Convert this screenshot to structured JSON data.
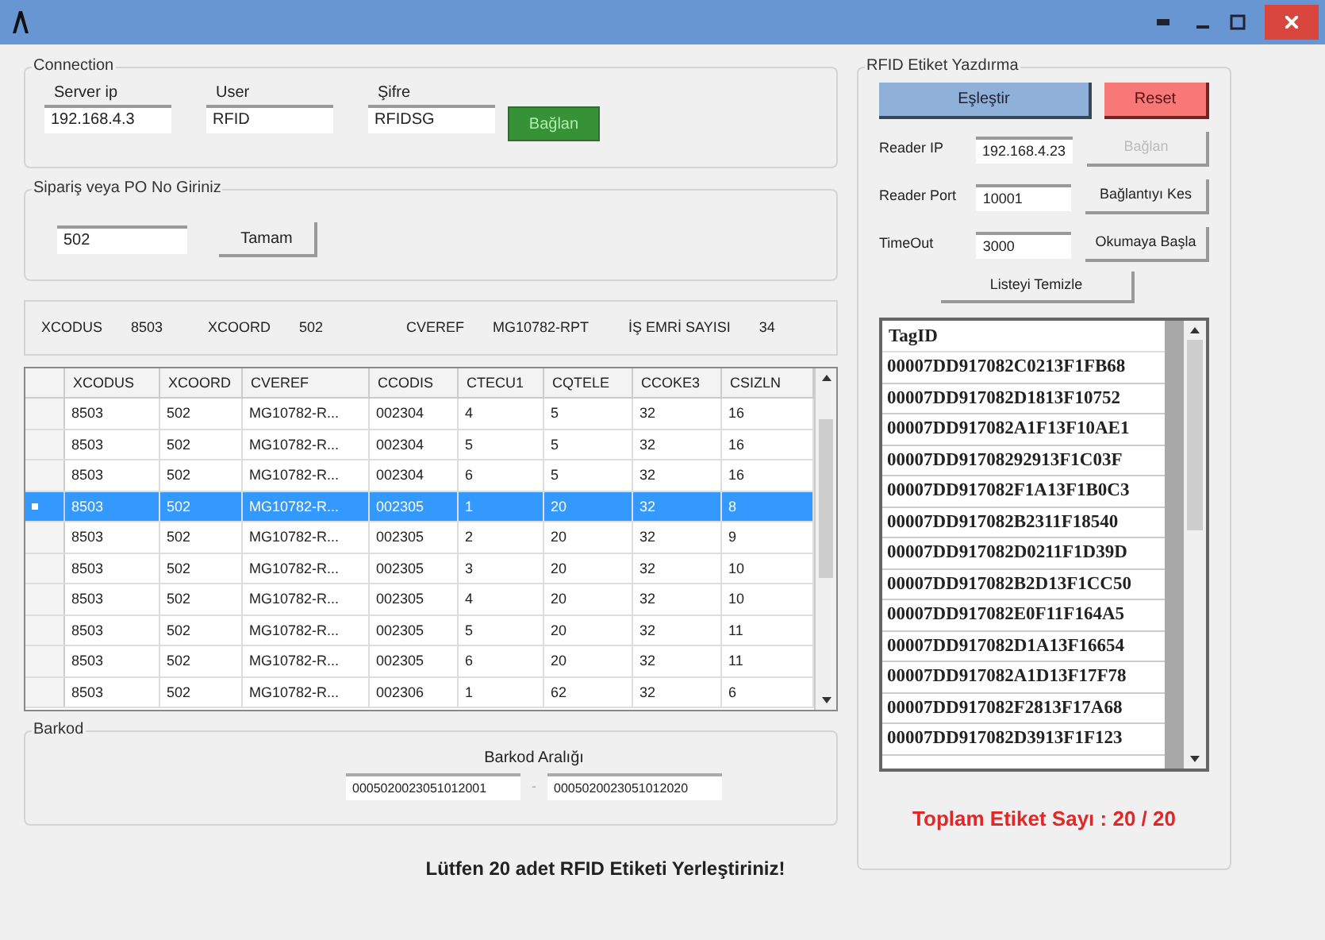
{
  "connection": {
    "title": "Connection",
    "fields": [
      {
        "label": "Server ip",
        "value": "192.168.4.3"
      },
      {
        "label": "User",
        "value": "RFID"
      },
      {
        "label": "Şifre",
        "value": "RFIDSG"
      }
    ],
    "button": {
      "label": "Bağlan",
      "kind": "success",
      "disabled": true
    }
  },
  "order": {
    "title": "Sipariş veya PO No Giriniz",
    "value": "502",
    "button": "Tamam"
  },
  "info": [
    {
      "label": "XCODUS",
      "value": "8503"
    },
    {
      "label": "XCOORD",
      "value": "502"
    },
    {
      "label": "CVEREF",
      "value": "MG10782-RPT"
    },
    {
      "label": "İŞ EMRİ SAYISI",
      "value": "34"
    }
  ],
  "table": {
    "columns": [
      "XCODUS",
      "XCOORD",
      "CVEREF",
      "CCODIS",
      "CTECU1",
      "CQTELE",
      "CCOKE3",
      "CSIZLN"
    ],
    "rows": [
      {
        "selected": false,
        "cells": [
          "8503",
          "502",
          "MG10782-R...",
          "002304",
          "4",
          "5",
          "32",
          "16"
        ]
      },
      {
        "selected": false,
        "cells": [
          "8503",
          "502",
          "MG10782-R...",
          "002304",
          "5",
          "5",
          "32",
          "16"
        ]
      },
      {
        "selected": false,
        "cells": [
          "8503",
          "502",
          "MG10782-R...",
          "002304",
          "6",
          "5",
          "32",
          "16"
        ]
      },
      {
        "selected": true,
        "cells": [
          "8503",
          "502",
          "MG10782-R...",
          "002305",
          "1",
          "20",
          "32",
          "8"
        ]
      },
      {
        "selected": false,
        "cells": [
          "8503",
          "502",
          "MG10782-R...",
          "002305",
          "2",
          "20",
          "32",
          "9"
        ]
      },
      {
        "selected": false,
        "cells": [
          "8503",
          "502",
          "MG10782-R...",
          "002305",
          "3",
          "20",
          "32",
          "10"
        ]
      },
      {
        "selected": false,
        "cells": [
          "8503",
          "502",
          "MG10782-R...",
          "002305",
          "4",
          "20",
          "32",
          "10"
        ]
      },
      {
        "selected": false,
        "cells": [
          "8503",
          "502",
          "MG10782-R...",
          "002305",
          "5",
          "20",
          "32",
          "11"
        ]
      },
      {
        "selected": false,
        "cells": [
          "8503",
          "502",
          "MG10782-R...",
          "002305",
          "6",
          "20",
          "32",
          "11"
        ]
      },
      {
        "selected": false,
        "cells": [
          "8503",
          "502",
          "MG10782-R...",
          "002306",
          "1",
          "62",
          "32",
          "6"
        ]
      }
    ]
  },
  "barcode": {
    "title": "Barkod",
    "range_label": "Barkod Aralığı",
    "from": "0005020023051012001",
    "separator": "-",
    "to": "0005020023051012020"
  },
  "message": "Lütfen 20 adet RFID Etiketi Yerleştiriniz!",
  "rfid": {
    "title": "RFID Etiket Yazdırma",
    "top_buttons": [
      {
        "label": "Eşleştir",
        "kind": "primary"
      },
      {
        "label": "Reset",
        "kind": "danger"
      }
    ],
    "rows": [
      {
        "label": "Reader IP",
        "value": "192.168.4.23",
        "button": "Bağlan",
        "disabled": true
      },
      {
        "label": "Reader Port",
        "value": "10001",
        "button": "Bağlantıyı Kes",
        "disabled": false
      },
      {
        "label": "TimeOut",
        "value": "3000",
        "button": "Okumaya Başla",
        "disabled": false
      }
    ],
    "clear_button": "Listeyi Temizle",
    "list_header": "TagID",
    "tags": [
      "00007DD917082C0213F1FB68",
      "00007DD917082D1813F10752",
      "00007DD917082A1F13F10AE1",
      "00007DD91708292913F1C03F",
      "00007DD917082F1A13F1B0C3",
      "00007DD917082B2311F18540",
      "00007DD917082D0211F1D39D",
      "00007DD917082B2D13F1CC50",
      "00007DD917082E0F11F164A5",
      "00007DD917082D1A13F16654",
      "00007DD917082A1D13F17F78",
      "00007DD917082F2813F17A68",
      "00007DD917082D3913F1F123"
    ],
    "total": "Toplam Etiket Sayı : 20 / 20"
  }
}
